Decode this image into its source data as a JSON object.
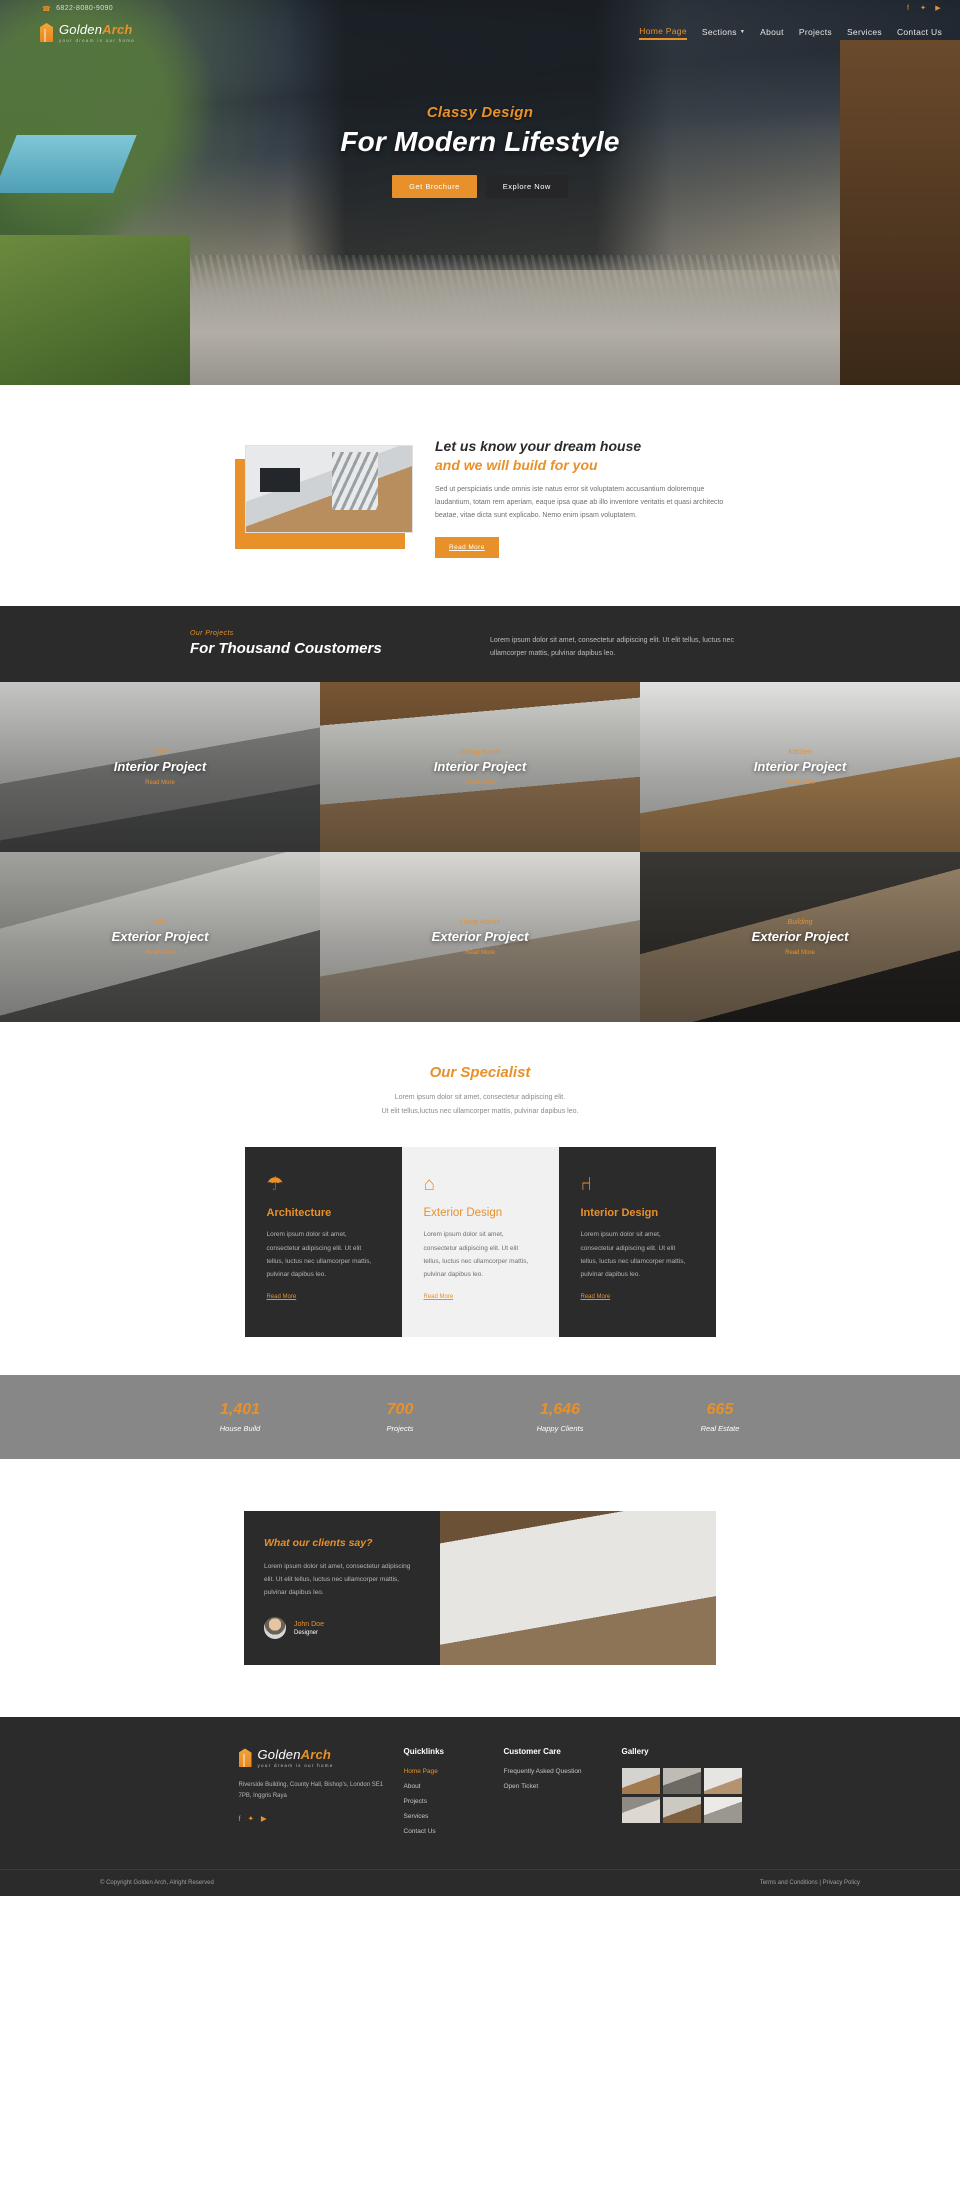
{
  "topbar": {
    "phone": "6822-8080-9090",
    "phone_icon": "phone-icon",
    "socials": [
      {
        "name": "facebook-icon",
        "glyph": "f"
      },
      {
        "name": "twitter-icon",
        "glyph": "✦"
      },
      {
        "name": "youtube-icon",
        "glyph": "▶"
      }
    ]
  },
  "brand": {
    "name": "Golden",
    "name_bold": "Arch",
    "tagline": "your dream is our home"
  },
  "nav": [
    {
      "label": "Home Page",
      "active": true,
      "caret": false
    },
    {
      "label": "Sections",
      "active": false,
      "caret": true
    },
    {
      "label": "About",
      "active": false,
      "caret": false
    },
    {
      "label": "Projects",
      "active": false,
      "caret": false
    },
    {
      "label": "Services",
      "active": false,
      "caret": false
    },
    {
      "label": "Contact Us",
      "active": false,
      "caret": false
    }
  ],
  "hero": {
    "kicker": "Classy Design",
    "title": "For Modern Lifestyle",
    "btn_primary": "Get Brochure",
    "btn_ghost": "Explore Now"
  },
  "about": {
    "heading_1": "Let us know your dream house",
    "heading_2": "and we will build for you",
    "paragraph": "Sed ut perspiciatis unde omnis iste natus error sit voluptatem accusantium doloremque laudantium, totam rem aperiam, eaque ipsa quae ab illo inventore veritatis et quasi architecto beatae, vitae dicta sunt explicabo. Nemo enim ipsam voluptatem.",
    "button": "Read More"
  },
  "projects": {
    "kicker": "Our Projects",
    "title": "For Thousand Coustomers",
    "description": "Lorem ipsum dolor sit amet, consectetur adipiscing elit. Ut elit tellus, luctus nec ullamcorper mattis, pulvinar dapibus leo.",
    "tiles": [
      {
        "kicker": "Office",
        "title": "Interior Project",
        "link": "Read More"
      },
      {
        "kicker": "Dining Room",
        "title": "Interior Project",
        "link": "Read More"
      },
      {
        "kicker": "Kitchen",
        "title": "Interior Project",
        "link": "Read More"
      },
      {
        "kicker": "Villa",
        "title": "Exterior Project",
        "link": "Read More"
      },
      {
        "kicker": "Living House",
        "title": "Exterior Project",
        "link": "Read More"
      },
      {
        "kicker": "Building",
        "title": "Exterior Project",
        "link": "Read More"
      }
    ]
  },
  "specialist": {
    "title": "Our Specialist",
    "subtitle_line1": "Lorem ipsum dolor sit amet, consectetur adipiscing elit.",
    "subtitle_line2": "Ut elit tellus,luctus nec ullamcorper mattis, pulvinar dapibus leo.",
    "cards": [
      {
        "icon": "compass-icon",
        "glyph": "☂",
        "title": "Architecture",
        "text": "Lorem ipsum dolor sit amet, consectetur adipiscing elit. Ut elit tellus, luctus nec ullamcorper mattis, pulvinar dapibus leo.",
        "link": "Read More"
      },
      {
        "icon": "home-icon",
        "glyph": "⌂",
        "title": "Exterior Design",
        "text": "Lorem ipsum dolor sit amet, consectetur adipiscing elit. Ut elit tellus, luctus nec ullamcorper mattis, pulvinar dapibus leo.",
        "link": "Read More"
      },
      {
        "icon": "chair-icon",
        "glyph": "⑁",
        "title": "Interior Design",
        "text": "Lorem ipsum dolor sit amet, consectetur adipiscing elit. Ut elit tellus, luctus nec ullamcorper mattis, pulvinar dapibus leo.",
        "link": "Read More"
      }
    ]
  },
  "stats": [
    {
      "number": "1,401",
      "label": "House Build"
    },
    {
      "number": "700",
      "label": "Projects"
    },
    {
      "number": "1,646",
      "label": "Happy Clients"
    },
    {
      "number": "665",
      "label": "Real Estate"
    }
  ],
  "testimonial": {
    "heading": "What our clients say?",
    "text": "Lorem ipsum dolor sit amet, consectetur adipiscing elit. Ut elit tellus, luctus nec ullamcorper mattis, pulvinar dapibus leo.",
    "person_name": "John Doe",
    "person_role": "Designer"
  },
  "footer": {
    "address": "Riverside Building, County Hall, Bishop's, London SE1 7PB, Inggris Raya",
    "socials": [
      {
        "name": "facebook-icon",
        "glyph": "f"
      },
      {
        "name": "twitter-icon",
        "glyph": "✦"
      },
      {
        "name": "youtube-icon",
        "glyph": "▶"
      }
    ],
    "quicklinks_title": "Quicklinks",
    "quicklinks": [
      {
        "label": "Home Page",
        "active": true
      },
      {
        "label": "About",
        "active": false
      },
      {
        "label": "Projects",
        "active": false
      },
      {
        "label": "Services",
        "active": false
      },
      {
        "label": "Contact Us",
        "active": false
      }
    ],
    "care_title": "Customer Care",
    "care": [
      {
        "label": "Frequently Asked Question"
      },
      {
        "label": "Open Ticket"
      }
    ],
    "gallery_title": "Gallery",
    "copyright": "© Copyright Golden Arch, Alright Reserved",
    "legal": "Terms and Conditions | Privacy Policy"
  },
  "colors": {
    "accent": "#e8912a",
    "dark": "#2b2b2b",
    "stats_bg": "#878787"
  }
}
